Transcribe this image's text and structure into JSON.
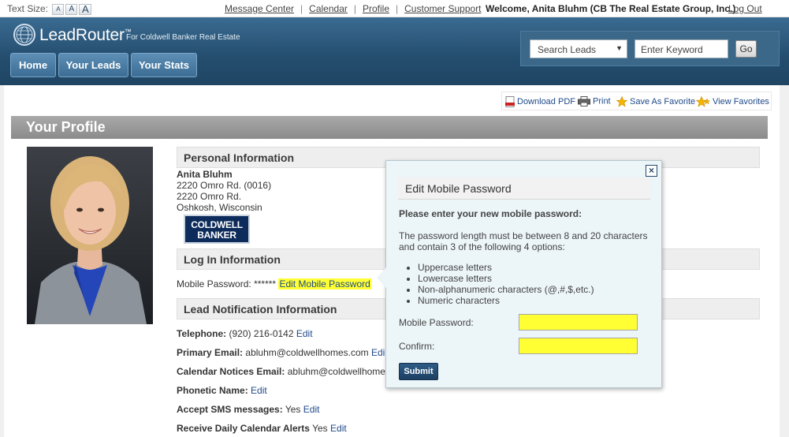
{
  "topbar": {
    "text_size_label": "Text Size:",
    "text_size_small": "A",
    "text_size_medium": "A",
    "text_size_large": "A",
    "links": [
      "Message Center",
      "Calendar",
      "Profile",
      "Customer Support"
    ],
    "separator": "|",
    "welcome": "Welcome, Anita Bluhm (CB The Real Estate Group, Inc.)",
    "logout": "Log Out"
  },
  "header": {
    "logo_name": "LeadRouter",
    "logo_tm": "™",
    "tagline": "For Coldwell Banker Real Estate",
    "nav": [
      "Home",
      "Your Leads",
      "Your Stats"
    ],
    "search": {
      "select_value": "Search Leads",
      "keyword_placeholder": "Enter Keyword",
      "go_label": "Go"
    }
  },
  "toolbar": {
    "download_pdf": "Download PDF",
    "print": "Print",
    "save_favorite": "Save As Favorite",
    "view_favorites": "View Favorites"
  },
  "page": {
    "title": "Your Profile"
  },
  "personal": {
    "heading": "Personal Information",
    "name": "Anita Bluhm",
    "address1": "2220 Omro Rd. (0016)",
    "address2": "2220 Omro Rd.",
    "city_state": "Oshkosh, Wisconsin",
    "brand_logo_line1": "COLDWELL",
    "brand_logo_line2": "BANKER"
  },
  "login": {
    "heading": "Log In Information",
    "mobile_password_label": "Mobile Password:",
    "mobile_password_mask": "******",
    "edit_link": "Edit Mobile Password"
  },
  "notifications": {
    "heading": "Lead Notification Information",
    "telephone_label": "Telephone:",
    "telephone_value": "(920) 216-0142",
    "primary_email_label": "Primary Email:",
    "primary_email_value": "abluhm@coldwellhomes.com",
    "calendar_email_label": "Calendar Notices Email:",
    "calendar_email_value": "abluhm@coldwellhome",
    "phonetic_label": "Phonetic Name:",
    "sms_label": "Accept SMS messages:",
    "sms_value": "Yes",
    "daily_alerts_label": "Receive Daily Calendar Alerts",
    "daily_alerts_value": "Yes",
    "edit": "Edit",
    "edit_truncated": "Edi"
  },
  "modal": {
    "close": "×",
    "title": "Edit Mobile Password",
    "instruction": "Please enter your new mobile password:",
    "rule_line1": "The password length must be between 8 and 20 characters",
    "rule_line2": "and contain 3 of the following 4 options:",
    "options": [
      "Uppercase letters",
      "Lowercase letters",
      "Non-alphanumeric characters (@,#,$,etc.)",
      "Numeric characters"
    ],
    "password_label": "Mobile Password:",
    "confirm_label": "Confirm:",
    "submit": "Submit"
  },
  "colors": {
    "header_blue": "#244d6e",
    "link_blue": "#1f4a8a",
    "highlight_yellow": "#ffff33",
    "page_bar_gray": "#8b8b8b"
  }
}
